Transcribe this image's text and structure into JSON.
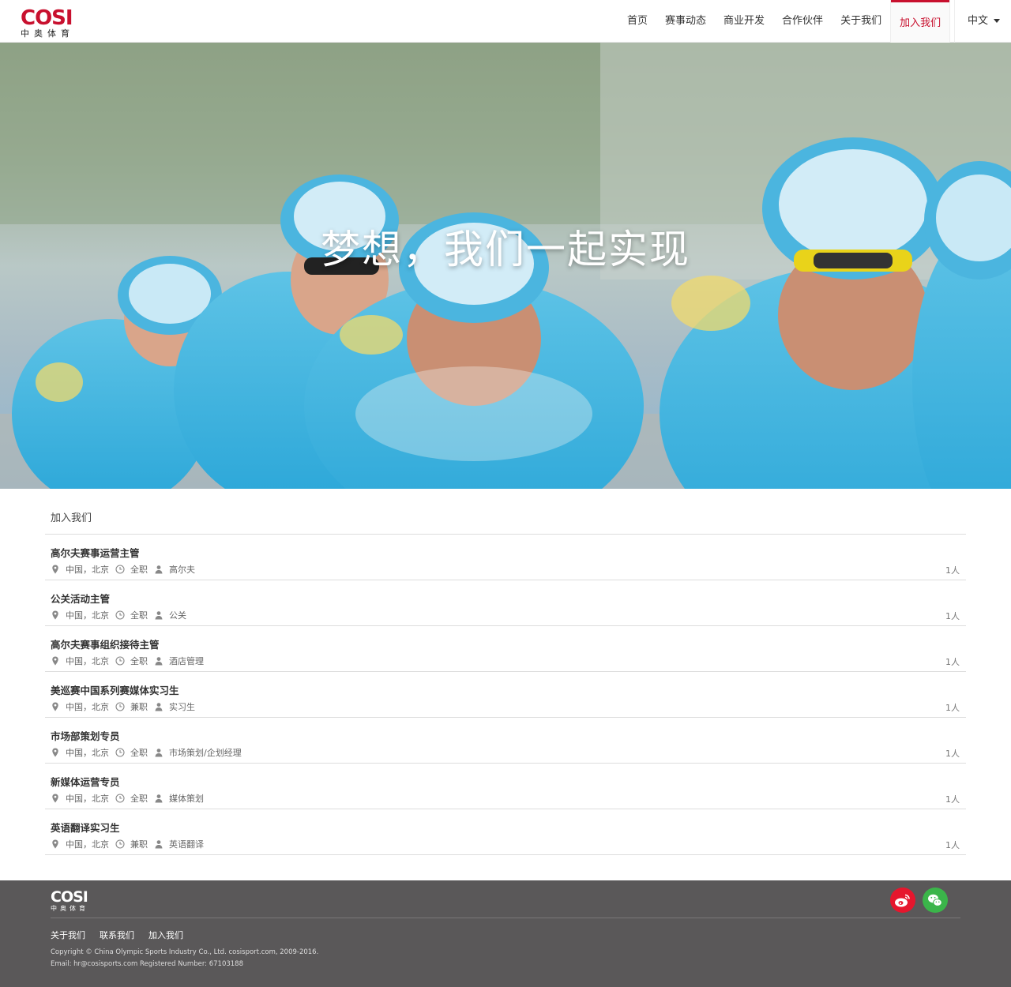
{
  "header": {
    "logo": {
      "word": "COSI",
      "sub": "中奥体育"
    },
    "nav": [
      {
        "label": "首页"
      },
      {
        "label": "赛事动态"
      },
      {
        "label": "商业开发"
      },
      {
        "label": "合作伙伴"
      },
      {
        "label": "关于我们"
      },
      {
        "label": "加入我们",
        "active": true
      }
    ],
    "language": "中文"
  },
  "hero": {
    "title": "梦想，我们一起实现"
  },
  "jobs_section": {
    "title": "加入我们",
    "jobs": [
      {
        "title": "高尔夫赛事运营主管",
        "location": "中国，北京",
        "type": "全职",
        "category": "高尔夫",
        "count": "1人"
      },
      {
        "title": "公关活动主管",
        "location": "中国，北京",
        "type": "全职",
        "category": "公关",
        "count": "1人"
      },
      {
        "title": "高尔夫赛事组织接待主管",
        "location": "中国，北京",
        "type": "全职",
        "category": "酒店管理",
        "count": "1人"
      },
      {
        "title": "美巡赛中国系列赛媒体实习生",
        "location": "中国，北京",
        "type": "兼职",
        "category": "实习生",
        "count": "1人"
      },
      {
        "title": "市场部策划专员",
        "location": "中国，北京",
        "type": "全职",
        "category": "市场策划/企划经理",
        "count": "1人"
      },
      {
        "title": "新媒体运营专员",
        "location": "中国，北京",
        "type": "全职",
        "category": "媒体策划",
        "count": "1人"
      },
      {
        "title": "英语翻译实习生",
        "location": "中国，北京",
        "type": "兼职",
        "category": "英语翻译",
        "count": "1人"
      }
    ]
  },
  "footer": {
    "logo": {
      "word": "COSI",
      "sub": "中奥体育"
    },
    "links": [
      "关于我们",
      "联系我们",
      "加入我们"
    ],
    "copyright": "Copyright © China Olympic Sports Industry Co., Ltd. cosisport.com, 2009-2016.",
    "contact": "Email: hr@cosisports.com Registered Number: 67103188",
    "social": [
      "weibo-icon",
      "wechat-icon"
    ]
  },
  "colors": {
    "brand_red": "#c8102e",
    "footer_bg": "#5a5859",
    "weibo": "#e6162d",
    "wechat": "#3bb54a"
  }
}
